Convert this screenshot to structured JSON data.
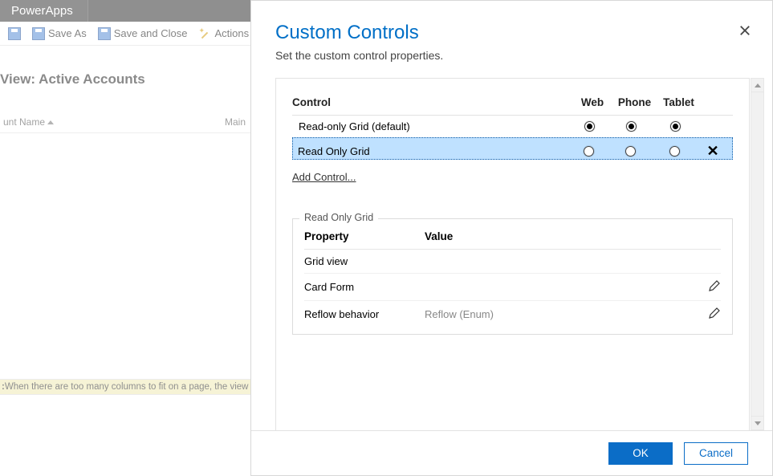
{
  "app": {
    "name": "PowerApps"
  },
  "toolbar": {
    "save_as": "Save As",
    "save_close": "Save and Close",
    "actions": "Actions"
  },
  "view": {
    "heading": "View: Active Accounts"
  },
  "grid_columns": {
    "name": "unt Name",
    "main": "Main"
  },
  "note": {
    "prefix": ":",
    "text": " When there are too many columns to fit on a page, the view "
  },
  "modal": {
    "title": "Custom Controls",
    "subtitle": "Set the custom control properties.",
    "close_icon": "close-icon",
    "controls_header": {
      "control": "Control",
      "web": "Web",
      "phone": "Phone",
      "tablet": "Tablet"
    },
    "controls": [
      {
        "name": "Read-only Grid (default)",
        "web": true,
        "phone": true,
        "tablet": true,
        "removable": false
      },
      {
        "name": "Read Only Grid",
        "web": false,
        "phone": false,
        "tablet": false,
        "removable": true
      }
    ],
    "add_control": "Add Control...",
    "props": {
      "legend": "Read Only Grid",
      "header": {
        "property": "Property",
        "value": "Value"
      },
      "rows": [
        {
          "label": "Grid view",
          "value": "",
          "editable": false
        },
        {
          "label": "Card Form",
          "value": "",
          "editable": true
        },
        {
          "label": "Reflow behavior",
          "value": "Reflow (Enum)",
          "editable": true
        }
      ]
    },
    "buttons": {
      "ok": "OK",
      "cancel": "Cancel"
    }
  }
}
